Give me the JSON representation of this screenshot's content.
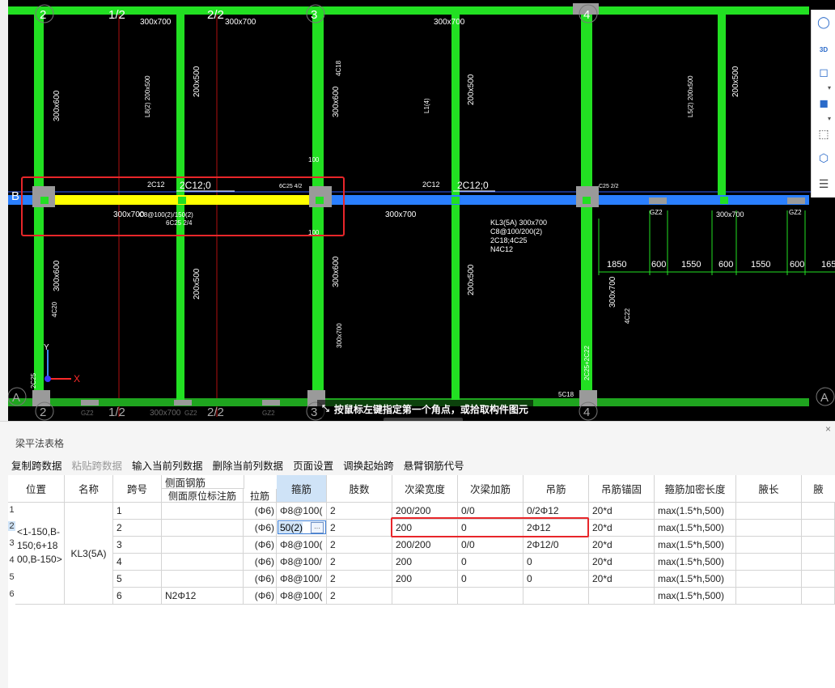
{
  "canvas": {
    "axis_labels": {
      "top": [
        "2",
        "1/2",
        "2/2",
        "3",
        "4"
      ],
      "bottom": [
        "2",
        "1/2",
        "2/2",
        "3",
        "4"
      ],
      "rows": [
        "B",
        "A",
        "A"
      ]
    },
    "beam_annotations": {
      "a1": "2C12;0",
      "a2": "2C12;0",
      "a3": "2C12",
      "a4": "2C12",
      "b1": "300x700",
      "b2": "300x700",
      "b3": "300x700",
      "b4": "300x700",
      "b5": "300x700",
      "b6": "300x700",
      "b7": "300x700",
      "b8": "300x700",
      "b9": "300x700",
      "c1": "6C25 2/4",
      "c2": "C8@100(2)/150(2)",
      "c3": "6C25 4/2",
      "c4": "C25 2/2",
      "gz": "GZ2",
      "dims": [
        "1850",
        "600",
        "1550",
        "600",
        "1550",
        "600",
        "165"
      ],
      "kl3": [
        "KL3(5A) 300x700",
        "C8@100/200(2)",
        "2C18;4C25",
        "N4C12"
      ],
      "col": [
        "300x600",
        "200x500",
        "200x500",
        "300x600",
        "300x600",
        "300x600",
        "200x500",
        "200x500",
        "200x500",
        "300x700"
      ],
      "misc": [
        "4C20",
        "2C25",
        "4C18",
        "100",
        "100",
        "2C25+2C22",
        "5C18",
        "4C22",
        "300x700",
        "L1(4)",
        "L8(2) 200x500",
        "L5(2) 200x500"
      ]
    },
    "coord": {
      "y": "Y",
      "x": "X"
    },
    "status_tip": "按鼠标左键指定第一个角点，或拾取构件图元"
  },
  "right_toolbar": [
    {
      "icon": "orbit-icon"
    },
    {
      "icon": "3d-view-icon",
      "label": "3D"
    },
    {
      "icon": "cube-view-icon"
    },
    {
      "icon": "solid-cube-icon"
    },
    {
      "icon": "select-box-icon"
    },
    {
      "icon": "component-cube-icon"
    },
    {
      "icon": "list-view-icon"
    }
  ],
  "panel": {
    "title": "梁平法表格",
    "close": "×",
    "toolbar": [
      "复制跨数据",
      "粘贴跨数据",
      "输入当前列数据",
      "删除当前列数据",
      "页面设置",
      "调换起始跨",
      "悬臂钢筋代号"
    ],
    "headers": {
      "position": "位置",
      "name": "名称",
      "span": "跨号",
      "side_group": "侧面钢筋",
      "side_sub": "侧面原位标注筋",
      "tie": "拉筋",
      "stirrup": "箍筋",
      "legs": "肢数",
      "sec_width": "次梁宽度",
      "sec_add": "次梁加筋",
      "hanger": "吊筋",
      "hanger_anchor": "吊筋锚固",
      "dense_len": "箍筋加密长度",
      "haunch_len": "腋长",
      "haunch": "腋"
    },
    "position_value": "<1-150,B-150;6+1800,B-150>",
    "name_value": "KL3(5A)",
    "editing_value": "50(2)",
    "editing_btn": "···",
    "rows": [
      {
        "num": "1",
        "span": "1",
        "side": "",
        "tie": "(Φ6)",
        "stirrup": "Φ8@100(",
        "legs": "2",
        "sec_width": "200/200",
        "sec_add": "0/0",
        "hanger": "0/2Φ12",
        "anchor": "20*d",
        "dense": "max(1.5*h,500)"
      },
      {
        "num": "2",
        "span": "2",
        "side": "",
        "tie": "(Φ6)",
        "stirrup": "",
        "legs": "2",
        "sec_width": "200",
        "sec_add": "0",
        "hanger": "2Φ12",
        "anchor": "20*d",
        "dense": "max(1.5*h,500)"
      },
      {
        "num": "3",
        "span": "3",
        "side": "",
        "tie": "(Φ6)",
        "stirrup": "Φ8@100(",
        "legs": "2",
        "sec_width": "200/200",
        "sec_add": "0/0",
        "hanger": "2Φ12/0",
        "anchor": "20*d",
        "dense": "max(1.5*h,500)"
      },
      {
        "num": "4",
        "span": "4",
        "side": "",
        "tie": "(Φ6)",
        "stirrup": "Φ8@100/",
        "legs": "2",
        "sec_width": "200",
        "sec_add": "0",
        "hanger": "0",
        "anchor": "20*d",
        "dense": "max(1.5*h,500)"
      },
      {
        "num": "5",
        "span": "5",
        "side": "",
        "tie": "(Φ6)",
        "stirrup": "Φ8@100/",
        "legs": "2",
        "sec_width": "200",
        "sec_add": "0",
        "hanger": "0",
        "anchor": "20*d",
        "dense": "max(1.5*h,500)"
      },
      {
        "num": "6",
        "span": "6",
        "side": "N2Φ12",
        "tie": "(Φ6)",
        "stirrup": "Φ8@100(",
        "legs": "2",
        "sec_width": "",
        "sec_add": "",
        "hanger": "",
        "anchor": "",
        "dense": "max(1.5*h,500)"
      }
    ]
  },
  "colors": {
    "canvas_bg": "#000000",
    "column_green": "#22e022",
    "beam_blue": "#2a7fff",
    "highlight_yellow": "#ffff00",
    "grid_red": "#cc1010",
    "highlight_box": "#e8262a",
    "header_active": "#cfe3f7"
  }
}
